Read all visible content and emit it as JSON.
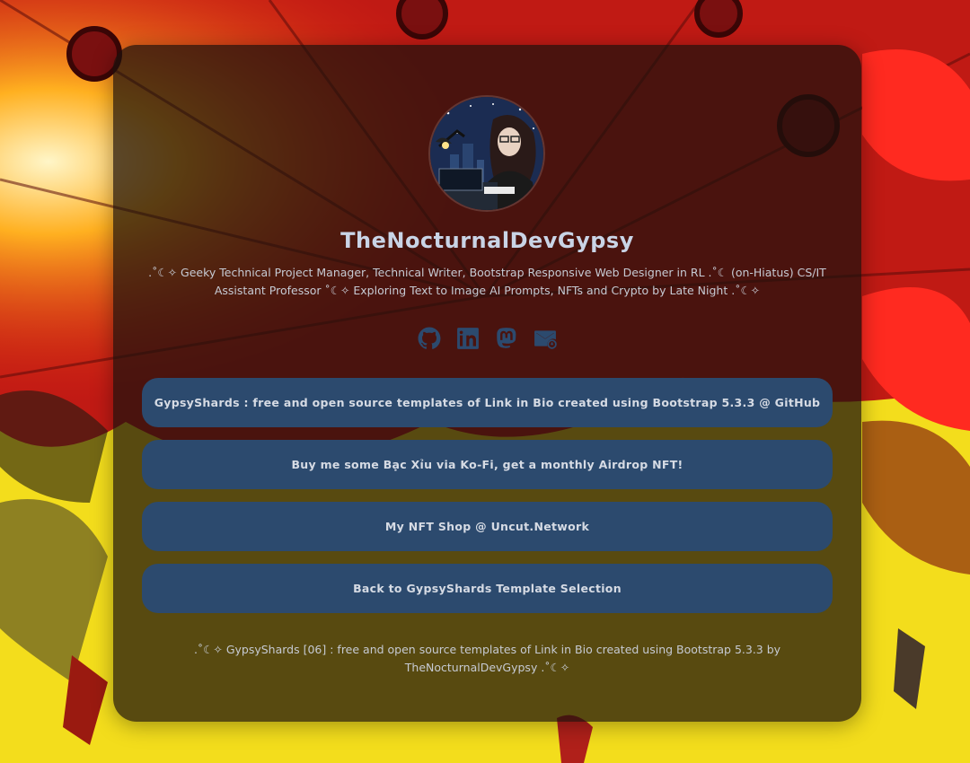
{
  "profile": {
    "name": "TheNocturnalDevGypsy",
    "bio": ".˚☾✧ Geeky Technical Project Manager, Technical Writer, Bootstrap Responsive Web Designer in RL .˚☾ (on-Hiatus) CS/IT Assistant Professor ˚☾✧ Exploring Text to Image AI Prompts, NFTs and Crypto by Late Night .˚☾✧"
  },
  "socials": [
    {
      "icon": "github-icon"
    },
    {
      "icon": "linkedin-icon"
    },
    {
      "icon": "mastodon-icon"
    },
    {
      "icon": "email-icon"
    }
  ],
  "links": [
    {
      "label": "GypsyShards : free and open source templates of Link in Bio created using Bootstrap 5.3.3 @ GitHub"
    },
    {
      "label": "Buy me some Bạc Xỉu via Ko-Fi, get a monthly Airdrop NFT!"
    },
    {
      "label": "My NFT Shop @ Uncut.Network"
    },
    {
      "label": "Back to GypsyShards Template Selection"
    }
  ],
  "footer": {
    "text": ".˚☾✧ GypsyShards [06] : free and open source templates of Link in Bio created using Bootstrap 5.3.3 by TheNocturnalDevGypsy .˚☾✧"
  },
  "colors": {
    "button_bg": "#2c4a6e",
    "icon_color": "#2c4a6e",
    "name_color": "#c9d4e6",
    "card_bg": "rgba(28,16,12,0.72)"
  }
}
